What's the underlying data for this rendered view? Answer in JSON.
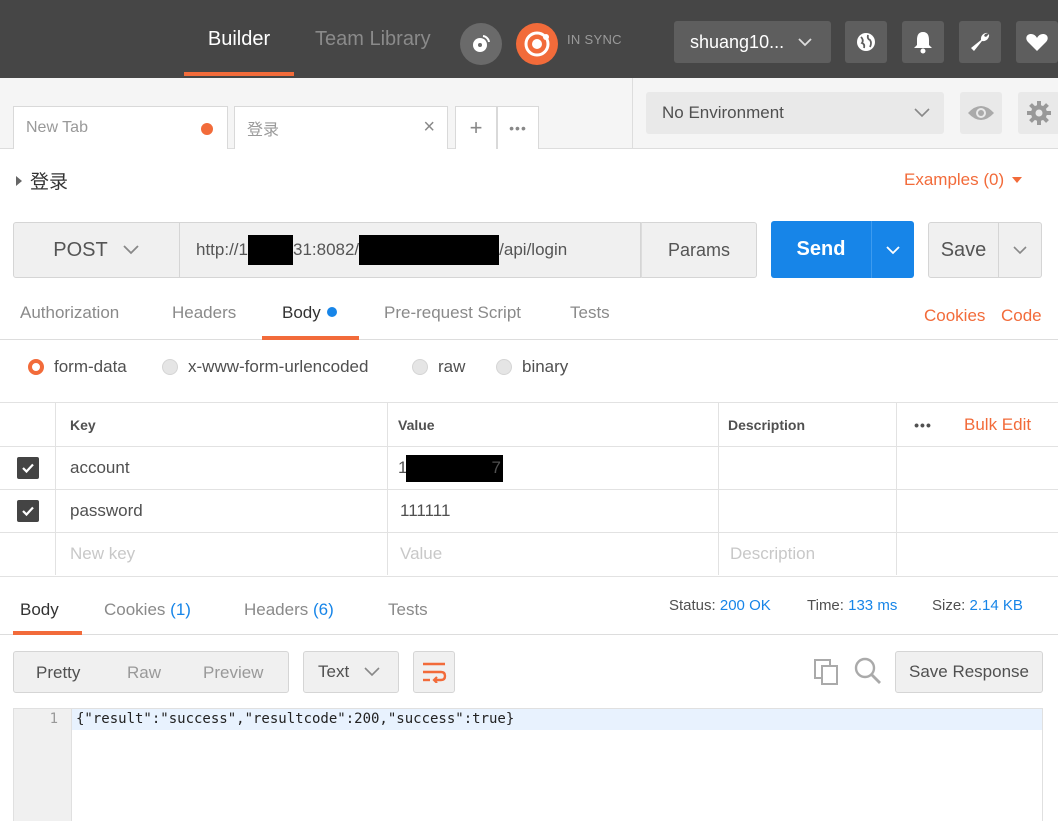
{
  "header": {
    "builder_label": "Builder",
    "team_library_label": "Team Library",
    "sync_status": "IN SYNC",
    "username": "shuang10...",
    "icons": [
      "satellite-icon",
      "sync-icon",
      "globe-icon",
      "bell-icon",
      "wrench-icon",
      "heart-icon"
    ]
  },
  "tabs": {
    "items": [
      {
        "label": "New Tab",
        "unsaved": true
      },
      {
        "label": "登录"
      }
    ],
    "add_label": "+",
    "more_label": "•••"
  },
  "environment": {
    "selected": "No Environment"
  },
  "request": {
    "name": "登录",
    "examples_label": "Examples (0)",
    "method": "POST",
    "url_prefix": "http://1",
    "url_mid": "31:8082/",
    "url_suffix": "/api/login",
    "params_label": "Params",
    "send_label": "Send",
    "save_label": "Save"
  },
  "request_tabs": {
    "authorization": "Authorization",
    "headers": "Headers",
    "body": "Body",
    "prerequest": "Pre-request Script",
    "tests": "Tests",
    "cookies": "Cookies",
    "code": "Code"
  },
  "body_types": {
    "form_data": "form-data",
    "urlencoded": "x-www-form-urlencoded",
    "raw": "raw",
    "binary": "binary",
    "selected": "form-data"
  },
  "kv_table": {
    "headers": {
      "key": "Key",
      "value": "Value",
      "description": "Description",
      "more": "•••",
      "bulk_edit": "Bulk Edit"
    },
    "rows": [
      {
        "checked": true,
        "key": "account",
        "value_prefix": "1",
        "value_suffix": "7",
        "description": ""
      },
      {
        "checked": true,
        "key": "password",
        "value": "111111",
        "description": ""
      }
    ],
    "placeholders": {
      "key": "New key",
      "value": "Value",
      "description": "Description"
    }
  },
  "response": {
    "tabs": {
      "body": "Body",
      "cookies": "Cookies",
      "cookies_count": "(1)",
      "headers": "Headers",
      "headers_count": "(6)",
      "tests": "Tests"
    },
    "status_label": "Status:",
    "status_value": "200 OK",
    "time_label": "Time:",
    "time_value": "133 ms",
    "size_label": "Size:",
    "size_value": "2.14 KB",
    "view_modes": {
      "pretty": "Pretty",
      "raw": "Raw",
      "preview": "Preview"
    },
    "format": "Text",
    "save_response_label": "Save Response",
    "line_number": "1",
    "body_text": "{\"result\":\"success\",\"resultcode\":200,\"success\":true}"
  },
  "colors": {
    "accent": "#f26b3a",
    "primary": "#1785e8",
    "header_bg": "#464646"
  }
}
